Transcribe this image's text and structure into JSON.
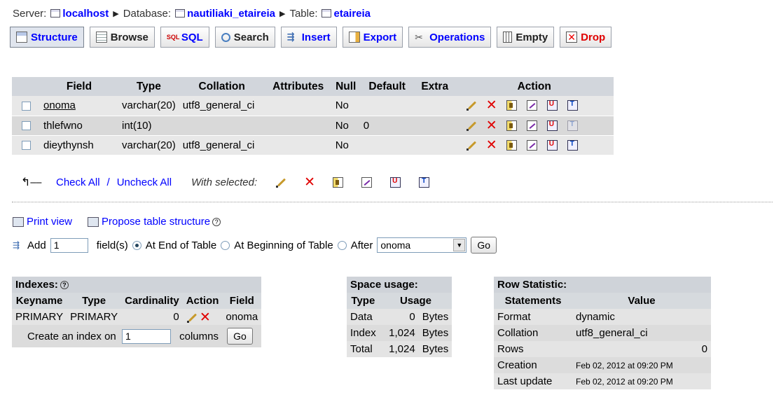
{
  "breadcrumb": {
    "server_label": "Server:",
    "server_value": "localhost",
    "database_label": "Database:",
    "database_value": "nautiliaki_etaireia",
    "table_label": "Table:",
    "table_value": "etaireia"
  },
  "tabs": [
    {
      "label": "Structure",
      "icon": "structure-icon",
      "active": true
    },
    {
      "label": "Browse",
      "icon": "browse-icon"
    },
    {
      "label": "SQL",
      "icon": "sql-icon"
    },
    {
      "label": "Search",
      "icon": "search-icon"
    },
    {
      "label": "Insert",
      "icon": "insert-icon"
    },
    {
      "label": "Export",
      "icon": "export-icon"
    },
    {
      "label": "Operations",
      "icon": "operations-icon"
    },
    {
      "label": "Empty",
      "icon": "empty-icon"
    },
    {
      "label": "Drop",
      "icon": "drop-icon"
    }
  ],
  "structure": {
    "headers": [
      "Field",
      "Type",
      "Collation",
      "Attributes",
      "Null",
      "Default",
      "Extra",
      "Action"
    ],
    "rows": [
      {
        "field": "onoma",
        "type": "varchar(20)",
        "collation": "utf8_general_ci",
        "attributes": "",
        "null": "No",
        "default": "",
        "extra": ""
      },
      {
        "field": "thlefwno",
        "type": "int(10)",
        "collation": "",
        "attributes": "",
        "null": "No",
        "default": "0",
        "extra": ""
      },
      {
        "field": "dieythynsh",
        "type": "varchar(20)",
        "collation": "utf8_general_ci",
        "attributes": "",
        "null": "No",
        "default": "",
        "extra": ""
      }
    ]
  },
  "selection": {
    "check_all": "Check All",
    "divider": "/",
    "uncheck_all": "Uncheck All",
    "with_selected": "With selected:"
  },
  "tools": {
    "print_view": "Print view",
    "propose": "Propose table structure"
  },
  "add_fields": {
    "add_label": "Add",
    "count": "1",
    "fields_label": "field(s)",
    "end_label": "At End of Table",
    "beginning_label": "At Beginning of Table",
    "after_label": "After",
    "after_field": "onoma",
    "go": "Go"
  },
  "indexes": {
    "title": "Indexes:",
    "headers": [
      "Keyname",
      "Type",
      "Cardinality",
      "Action",
      "Field"
    ],
    "rows": [
      {
        "keyname": "PRIMARY",
        "type": "PRIMARY",
        "cardinality": "0",
        "field": "onoma"
      }
    ],
    "create_label": "Create an index on",
    "create_count": "1",
    "columns_label": "columns",
    "go": "Go"
  },
  "space_usage": {
    "title": "Space usage:",
    "headers": [
      "Type",
      "Usage"
    ],
    "rows": [
      {
        "type": "Data",
        "amount": "0",
        "unit": "Bytes"
      },
      {
        "type": "Index",
        "amount": "1,024",
        "unit": "Bytes"
      },
      {
        "type": "Total",
        "amount": "1,024",
        "unit": "Bytes"
      }
    ]
  },
  "row_statistic": {
    "title": "Row Statistic:",
    "headers": [
      "Statements",
      "Value"
    ],
    "rows": [
      {
        "statement": "Format",
        "value": "dynamic"
      },
      {
        "statement": "Collation",
        "value": "utf8_general_ci"
      },
      {
        "statement": "Rows",
        "value": "0"
      },
      {
        "statement": "Creation",
        "value": "Feb 02, 2012 at 09:20 PM"
      },
      {
        "statement": "Last update",
        "value": "Feb 02, 2012 at 09:20 PM"
      }
    ]
  }
}
